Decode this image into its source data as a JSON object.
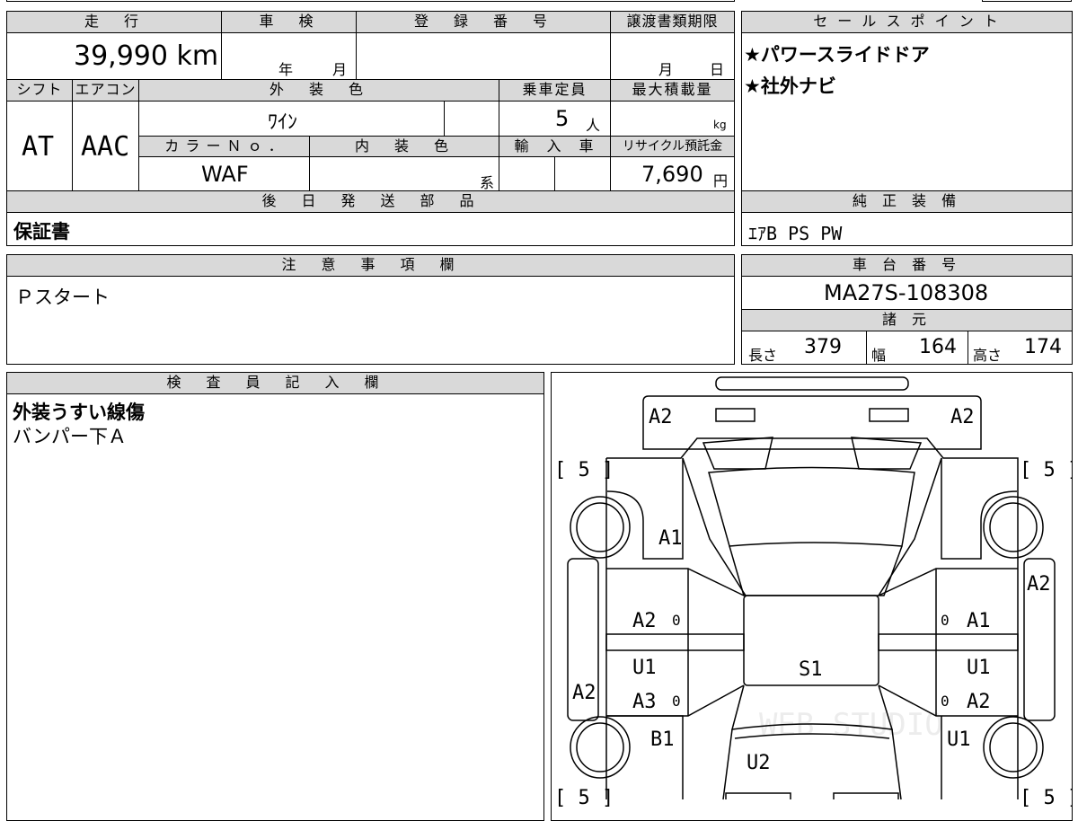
{
  "top_labels": {
    "mileage": "走　行",
    "inspection": "車　検",
    "registration": "登　録　番　号",
    "transfer_deadline": "譲渡書類期限",
    "shift": "シフト",
    "aircon": "エアコン",
    "exterior_color": "外　装　色",
    "capacity": "乗車定員",
    "max_load": "最大積載量",
    "color_no": "カ ラ ー Ｎ ｏ ．",
    "interior_color": "内　装　色",
    "import": "輸　入　車",
    "recycle_fee": "リサイクル預託金",
    "later_parts": "後　日　発　送　部　品"
  },
  "values": {
    "mileage": "39,990 km",
    "inspection_year_unit": "年",
    "inspection_month_unit": "月",
    "transfer_month_unit": "月",
    "transfer_day_unit": "日",
    "shift": "AT",
    "aircon": "AAC",
    "exterior_color": "ﾜｲﾝ",
    "capacity": "5",
    "capacity_unit": "人",
    "max_load_unit": "kg",
    "color_no": "WAF",
    "interior_color_suffix": "系",
    "recycle_fee": "7,690",
    "recycle_unit": "円",
    "later_parts": "保証書"
  },
  "sales_points": {
    "title": "セ ー ル ス ポ イ ン ト",
    "items": [
      "★パワースライドドア",
      "★社外ナビ"
    ]
  },
  "standard_equipment": {
    "title": "純 正 装 備",
    "value": "ｴｱB PS PW"
  },
  "notes": {
    "title": "注　意　事　項　欄",
    "value": "Ｐスタート"
  },
  "chassis": {
    "title": "車 台 番 号",
    "value": "MA27S-108308",
    "spec_title": "諸 元",
    "length_label": "長さ",
    "length": "379",
    "width_label": "幅",
    "width": "164",
    "height_label": "高さ",
    "height": "174"
  },
  "inspector": {
    "title": "検　査　員　記　入　欄",
    "lines": [
      "外装うすい線傷",
      "バンパー下Ａ"
    ]
  },
  "diagram": {
    "labels": {
      "front_left": "A2",
      "front_right": "A2",
      "tire_fl": "[ 5 ]",
      "tire_fr": "[ 5 ]",
      "hood": "A1",
      "right_rear_panel": "A2",
      "left_front_door": "A2",
      "left_front_door_zero": "0",
      "left_rocker": "U1",
      "left_rear_door": "A3",
      "left_rear_door_zero": "0",
      "left_rear_panel": "A2",
      "roof": "S1",
      "right_front_door_zero": "0",
      "right_front_door": "A1",
      "right_rocker": "U1",
      "right_rear_door_zero": "0",
      "right_rear_door": "A2",
      "left_rear_fender": "B1",
      "right_rear_fender": "U1",
      "rear_gate": "U2",
      "tire_rl": "[ 5 ]",
      "tire_rr": "[ 5 ]"
    }
  },
  "watermark": "WEB STUDIO"
}
